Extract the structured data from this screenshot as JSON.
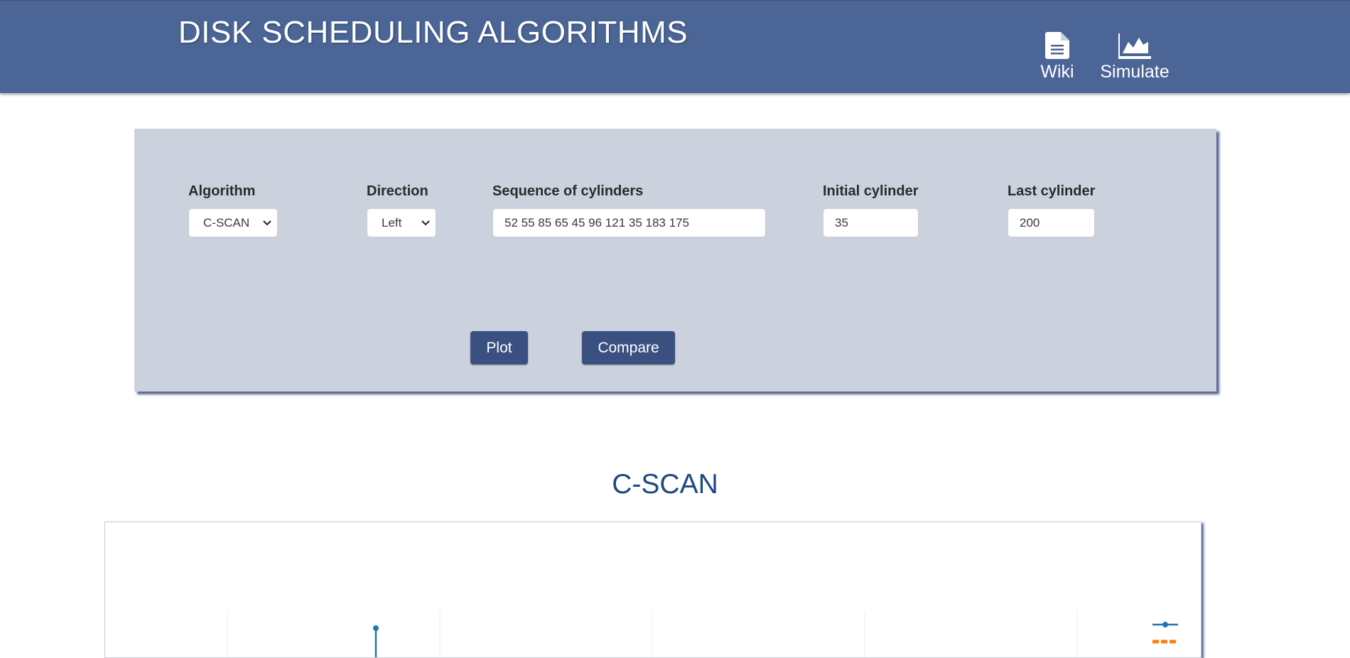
{
  "header": {
    "title": "DISK SCHEDULING ALGORITHMS",
    "nav": [
      {
        "label": "Wiki",
        "icon": "document-icon"
      },
      {
        "label": "Simulate",
        "icon": "area-chart-icon"
      }
    ]
  },
  "form": {
    "algorithm": {
      "label": "Algorithm",
      "value": "C-SCAN"
    },
    "direction": {
      "label": "Direction",
      "value": "Left"
    },
    "sequence": {
      "label": "Sequence of cylinders",
      "value": "52 55 85 65 45 96 121 35 183 175"
    },
    "initial": {
      "label": "Initial cylinder",
      "value": "35"
    },
    "last": {
      "label": "Last cylinder",
      "value": "200"
    },
    "plot_label": "Plot",
    "compare_label": "Compare"
  },
  "result": {
    "title": "C-SCAN"
  },
  "colors": {
    "header_bg": "#4a6596",
    "panel_bg": "#cbd2de",
    "button_bg": "#3a5080",
    "title_blue": "#1c4a84",
    "series_blue": "#1f77b4",
    "series_orange": "#ff7f0e"
  }
}
